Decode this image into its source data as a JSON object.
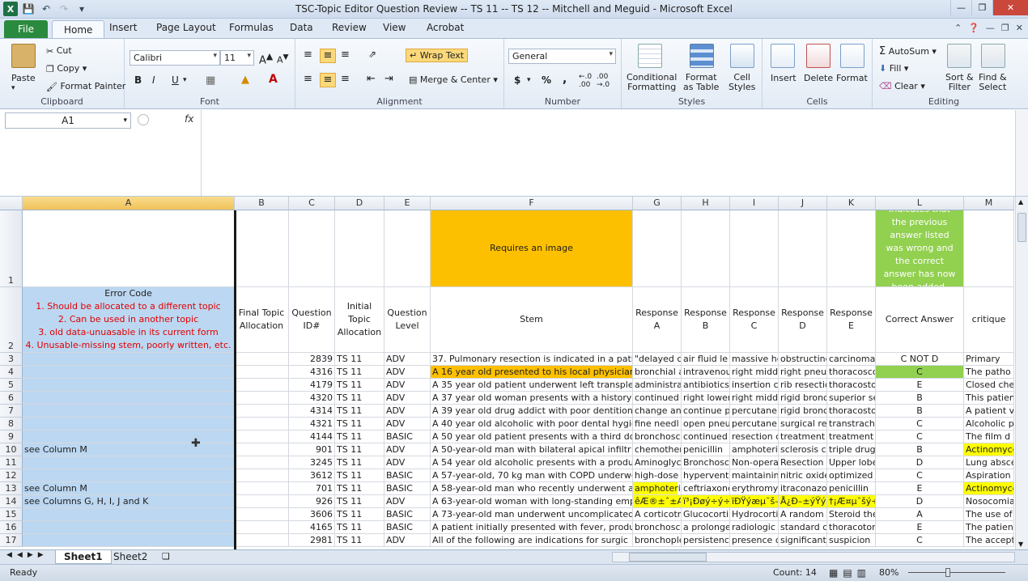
{
  "window": {
    "title": "TSC-Topic Editor Question Review -- TS 11 -- TS 12 -- Mitchell and Meguid  -  Microsoft Excel"
  },
  "tabs": [
    "File",
    "Home",
    "Insert",
    "Page Layout",
    "Formulas",
    "Data",
    "Review",
    "View",
    "Acrobat"
  ],
  "ribbon": {
    "clipboard": {
      "paste": "Paste",
      "cut": "Cut",
      "copy": "Copy",
      "format_painter": "Format Painter",
      "label": "Clipboard"
    },
    "font": {
      "name": "Calibri",
      "size": "11",
      "label": "Font",
      "bold": "B",
      "italic": "I",
      "underline": "U"
    },
    "alignment": {
      "wrap_text": "Wrap Text",
      "merge_center": "Merge & Center",
      "label": "Alignment"
    },
    "number": {
      "format": "General",
      "label": "Number",
      "currency": "$",
      "percent": "%",
      "comma": ","
    },
    "styles": {
      "conditional": "Conditional\nFormatting",
      "format_table": "Format\nas Table",
      "cell_styles": "Cell\nStyles",
      "label": "Styles"
    },
    "cells": {
      "insert": "Insert",
      "delete": "Delete",
      "format": "Format",
      "label": "Cells"
    },
    "editing": {
      "autosum": "AutoSum",
      "fill": "Fill",
      "clear": "Clear",
      "sort_filter": "Sort &\nFilter",
      "find_select": "Find &\nSelect",
      "label": "Editing"
    }
  },
  "formula_bar": {
    "name_box": "A1",
    "fx": "fx",
    "content": ""
  },
  "columns": [
    "A",
    "B",
    "C",
    "D",
    "E",
    "F",
    "G",
    "H",
    "I",
    "J",
    "K",
    "L",
    "M"
  ],
  "row_numbers": [
    "1",
    "2",
    "3",
    "4",
    "5",
    "6",
    "7",
    "8",
    "9",
    "10",
    "11",
    "12",
    "13",
    "14",
    "15",
    "16",
    "17"
  ],
  "row1": {
    "F": "Requires an image",
    "L": "Indicates that the previous answer listed was wrong and the correct answer has now been added."
  },
  "row2": {
    "A_title": "Error Code",
    "A_lines": [
      "1. Should be allocated to a different topic",
      "2. Can be used in another topic",
      "3. old data-unuasable in its current form",
      "4. Unusable-missing stem, poorly written, etc."
    ],
    "B": "Final Topic Allocation",
    "C": "Question ID#",
    "D": "Initial Topic Allocation",
    "E": "Question Level",
    "F": "Stem",
    "G": "Response A",
    "H": "Response B",
    "I": "Response C",
    "J": "Response D",
    "K": "Response E",
    "L": "Correct Answer",
    "M": "critique"
  },
  "data_rows": [
    {
      "A": "",
      "C": "2839",
      "D": "TS 11",
      "E": "ADV",
      "F": "37. Pulmonary resection is indicated in a pati",
      "G": "\"delayed c",
      "H": "air fluid le",
      "I": "massive he",
      "J": "obstructing",
      "K": "carcinoma",
      "L": "C NOT D",
      "M": "Primary"
    },
    {
      "A": "",
      "C": "4316",
      "D": "TS 11",
      "E": "ADV",
      "F": "A 16 year old presented to his local physician",
      "G": "bronchial a",
      "H": "intravenou",
      "I": "right midd",
      "J": "right pneu",
      "K": "thoracosco",
      "L": "C",
      "M": "The patho"
    },
    {
      "A": "",
      "C": "4179",
      "D": "TS 11",
      "E": "ADV",
      "F": "A 35 year old patient underwent left transple",
      "G": "administra",
      "H": "antibiotics",
      "I": "insertion c",
      "J": "rib resectio",
      "K": "thoracosto",
      "L": "E",
      "M": "Closed che"
    },
    {
      "A": "",
      "C": "4320",
      "D": "TS 11",
      "E": "ADV",
      "F": "A 37 year old woman presents with a history c",
      "G": "continued",
      "H": "right lower",
      "I": "right midd",
      "J": "rigid bronc",
      "K": "superior se",
      "L": "B",
      "M": "This patien"
    },
    {
      "A": "",
      "C": "4314",
      "D": "TS 11",
      "E": "ADV",
      "F": "A 39 year old drug addict  with poor dentition",
      "G": "change an",
      "H": "continue p",
      "I": "percutane",
      "J": "rigid bronc",
      "K": "thoracosto",
      "L": "B",
      "M": "A patient v"
    },
    {
      "A": "",
      "C": "4321",
      "D": "TS 11",
      "E": "ADV",
      "F": "A 40 year old alcoholic with poor dental hygie",
      "G": "fine needl",
      "H": "open pneu",
      "I": "percutane",
      "J": "surgical re",
      "K": "transtrach",
      "L": "C",
      "M": "Alcoholic p"
    },
    {
      "A": "",
      "C": "4144",
      "D": "TS 11",
      "E": "BASIC",
      "F": "A 50 year old patient presents with a third do",
      "G": "bronchosco",
      "H": "continued",
      "I": "resection c",
      "J": "treatment",
      "K": "treatment",
      "L": "C",
      "M": "The film d"
    },
    {
      "A": "see Column M",
      "C": "901",
      "D": "TS 11",
      "E": "ADV",
      "F": "A 50-year-old man with bilateral apical infiltr",
      "G": "chemother",
      "H": "penicillin",
      "I": "amphoteri",
      "J": "sclerosis c",
      "K": "triple drug",
      "L": "B",
      "M": "Actinomyco"
    },
    {
      "A": "",
      "C": "3245",
      "D": "TS 11",
      "E": "ADV",
      "F": "A 54 year old alcoholic presents with a produ",
      "G": "Aminoglyc",
      "H": "Bronchosc",
      "I": "Non-opera",
      "J": "Resection",
      "K": "Upper lobe",
      "L": "D",
      "M": "Lung absce"
    },
    {
      "A": "",
      "C": "3612",
      "D": "TS 11",
      "E": "BASIC",
      "F": "A 57-year-old, 70 kg man with COPD underwe",
      "G": "high-dose",
      "H": "hyperventi",
      "I": "maintainin",
      "J": "nitric oxide",
      "K": "optimized",
      "L": "C",
      "M": "Aspiration"
    },
    {
      "A": "see Column M",
      "C": "701",
      "D": "TS 11",
      "E": "BASIC",
      "F": "A 58-year-old man who recently underwent a",
      "G": "amphoteri",
      "H": "ceftriaxone",
      "I": "erythromy",
      "J": "itraconazo",
      "K": "penicillin",
      "L": "E",
      "M": "Actinomyco"
    },
    {
      "A": "see Columns G, H, I, J and K",
      "C": "926",
      "D": "TS 11",
      "E": "ADV",
      "F": "A 63-year-old woman with long-standing emp",
      "G": "êÆ®±ˆ±Æ Æ",
      "H": "ï³¡Ðøý÷ý÷-",
      "I": "ïÐŸýæµ˘š–¿",
      "J": "Å¿Ð–±ýŸýª",
      "K": "†¡Æ¤µ˘šý÷ý",
      "L": "D",
      "M": "Nosocomia"
    },
    {
      "A": "",
      "C": "3606",
      "D": "TS 11",
      "E": "BASIC",
      "F": "A 73-year-old man underwent uncomplicated",
      "G": "A corticotr",
      "H": "Glucocorti",
      "I": "Hydrocortis",
      "J": "A random",
      "K": "Steroid the",
      "L": "A",
      "M": "The use of"
    },
    {
      "A": "",
      "C": "4165",
      "D": "TS 11",
      "E": "BASIC",
      "F": "A patient initially presented with fever, produ",
      "G": "bronchosco",
      "H": "a prolonge",
      "I": "radiologic",
      "J": "standard c",
      "K": "thoracotom",
      "L": "E",
      "M": "The patien"
    },
    {
      "A": "",
      "C": "2981",
      "D": "TS 11",
      "E": "ADV",
      "F": "All of the following are indications for surgic",
      "G": "bronchople",
      "H": "persistenc",
      "I": "presence c",
      "J": "significant",
      "K": "suspicion",
      "L": "C",
      "M": "The accept"
    }
  ],
  "sheets": [
    "Sheet1",
    "Sheet2"
  ],
  "status": {
    "ready": "Ready",
    "count": "Count: 14",
    "zoom": "80%"
  }
}
